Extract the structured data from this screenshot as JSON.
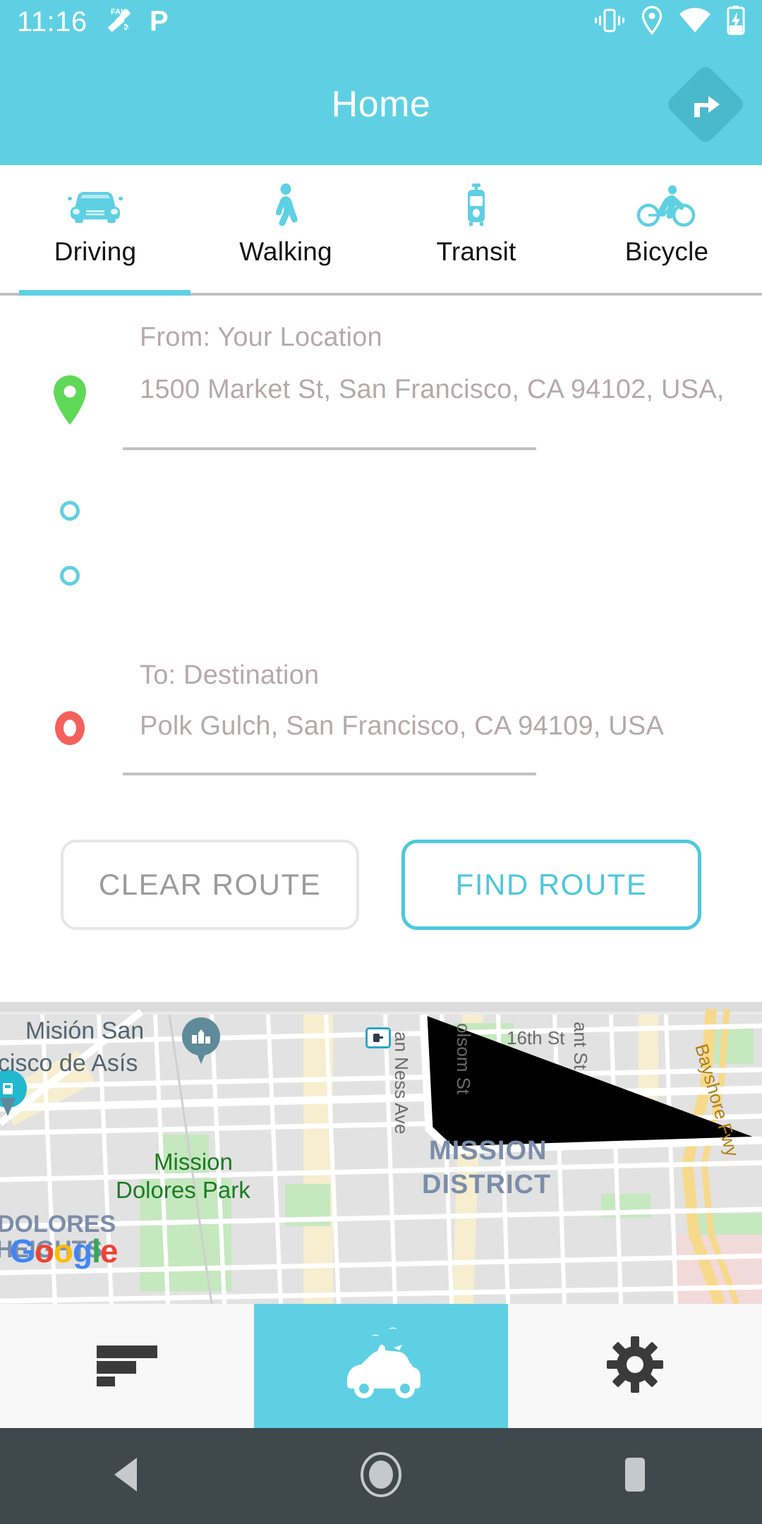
{
  "statusbar": {
    "time": "11:16",
    "left_icons": [
      {
        "name": "fake-gps-satellite-icon",
        "label": "FAKE"
      },
      {
        "name": "parking-p-icon",
        "label": "P"
      }
    ],
    "right_icons": [
      {
        "name": "vibrate-icon"
      },
      {
        "name": "location-pin-icon"
      },
      {
        "name": "wifi-icon"
      },
      {
        "name": "battery-charging-icon"
      }
    ]
  },
  "appbar": {
    "title": "Home",
    "action_icon": "directions-turn-right-icon",
    "background": "#5fd0e3",
    "action_background": "#4bb9cc"
  },
  "tabs": {
    "active_index": 0,
    "indicator_color": "#5fd0e3",
    "items": [
      {
        "label": "Driving",
        "icon": "car-icon"
      },
      {
        "label": "Walking",
        "icon": "pedestrian-icon"
      },
      {
        "label": "Transit",
        "icon": "tram-icon"
      },
      {
        "label": "Bicycle",
        "icon": "bicycle-icon"
      }
    ]
  },
  "route_form": {
    "from": {
      "label": "From: Your Location",
      "value": "1500 Market St, San Francisco, CA 94102, USA,",
      "marker_icon": "green-map-pin-icon",
      "marker_color": "#5fd857"
    },
    "waypoints": [
      {
        "marker_icon": "waypoint-dot-icon"
      },
      {
        "marker_icon": "waypoint-dot-icon"
      }
    ],
    "to": {
      "label": "To: Destination",
      "value": "Polk Gulch, San Francisco, CA 94109, USA",
      "marker_icon": "red-destination-ring-icon",
      "marker_color": "#f4615c"
    }
  },
  "buttons": {
    "clear": {
      "label": "CLEAR ROUTE",
      "color": "#9b9b9b",
      "border": "#e6e6e6"
    },
    "find": {
      "label": "FIND ROUTE",
      "color": "#4ec8dd",
      "border": "#4ec8dd"
    }
  },
  "map": {
    "attribution": "Google",
    "labels": [
      {
        "text": "Misión San",
        "type": "poi"
      },
      {
        "text": "ncisco de Asís",
        "type": "poi"
      },
      {
        "text": "an Ness Ave",
        "type": "street"
      },
      {
        "text": "olsom St",
        "type": "street"
      },
      {
        "text": "16th St",
        "type": "street"
      },
      {
        "text": "ant St",
        "type": "street"
      },
      {
        "text": "Bayshore Fwy",
        "type": "freeway"
      },
      {
        "text": "Mission",
        "type": "park"
      },
      {
        "text": "Dolores Park",
        "type": "park"
      },
      {
        "text": "MISSION",
        "type": "district"
      },
      {
        "text": "DISTRICT",
        "type": "district"
      },
      {
        "text": "DOLORES",
        "type": "neighborhood"
      },
      {
        "text": "HEIGHTS",
        "type": "neighborhood"
      }
    ]
  },
  "bottomnav": {
    "active_index": 1,
    "active_background": "#5fd0e3",
    "items": [
      {
        "icon": "list-lines-icon",
        "name": "trips"
      },
      {
        "icon": "car-travel-icon",
        "name": "drive"
      },
      {
        "icon": "gear-icon",
        "name": "settings"
      }
    ]
  },
  "system_nav": {
    "background": "#3f484c",
    "items": [
      {
        "icon": "back-triangle-icon"
      },
      {
        "icon": "home-circle-icon"
      },
      {
        "icon": "recents-square-icon"
      }
    ]
  }
}
